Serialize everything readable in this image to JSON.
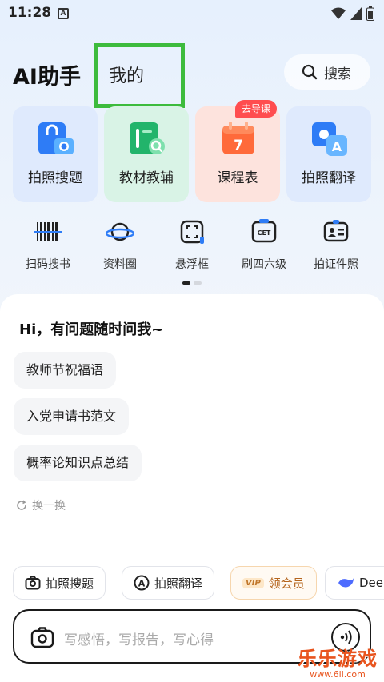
{
  "status_bar": {
    "time": "11:28",
    "notification_icon": "A"
  },
  "header": {
    "app_title": "AI助手",
    "tab_mine": "我的",
    "search_label": "搜索"
  },
  "feature_cards": [
    {
      "label": "拍照搜题",
      "icon": "camera-search-icon",
      "bg": "#dfeafd"
    },
    {
      "label": "教材教辅",
      "icon": "textbook-icon",
      "bg": "#d9f3e6"
    },
    {
      "label": "课程表",
      "icon": "calendar-icon",
      "bg": "#fde3dd",
      "badge": "去导课",
      "calendar_day": "7"
    },
    {
      "label": "拍照翻译",
      "icon": "photo-translate-icon",
      "bg": "#dfeafd"
    }
  ],
  "tools": [
    {
      "label": "扫码搜书",
      "icon": "barcode-icon"
    },
    {
      "label": "资料圈",
      "icon": "planet-icon"
    },
    {
      "label": "悬浮框",
      "icon": "floating-frame-icon"
    },
    {
      "label": "刷四六级",
      "icon": "cet-icon",
      "icon_text": "CET"
    },
    {
      "label": "拍证件照",
      "icon": "id-photo-icon"
    }
  ],
  "chat": {
    "greeting": "Hi，有问题随时问我~",
    "suggestions": [
      "教师节祝福语",
      "入党申请书范文",
      "概率论知识点总结"
    ],
    "refresh_label": "换一换"
  },
  "quick_chips": [
    {
      "label": "拍照搜题",
      "icon": "camera-icon"
    },
    {
      "label": "拍照翻译",
      "icon": "translate-icon"
    },
    {
      "label": "领会员",
      "icon": "vip-icon",
      "icon_text": "VIP"
    },
    {
      "label": "Dee",
      "icon": "whale-icon"
    }
  ],
  "input": {
    "placeholder": "写感悟，写报告，写心得"
  },
  "watermark": {
    "main": "乐乐游戏",
    "sub": "www.6ll.com"
  },
  "colors": {
    "accent": "#1677ff",
    "highlight_box": "#3dbb3d",
    "badge": "#ff4d4f"
  }
}
